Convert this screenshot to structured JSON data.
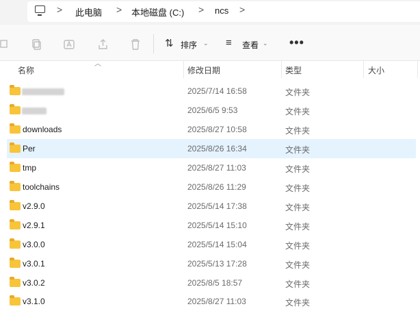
{
  "address_bar": {
    "crumbs": [
      "此电脑",
      "本地磁盘 (C:)",
      "ncs"
    ],
    "separator": ">"
  },
  "toolbar": {
    "sort_label": "排序",
    "view_label": "查看",
    "more_label": "•••"
  },
  "columns": {
    "name": "名称",
    "modified": "修改日期",
    "type": "类型",
    "size": "大小"
  },
  "files": [
    {
      "name": "",
      "modified": "2025/7/14 16:58",
      "type": "文件夹",
      "redacted": true
    },
    {
      "name": "",
      "modified": "2025/6/5 9:53",
      "type": "文件夹",
      "redacted": true
    },
    {
      "name": "downloads",
      "modified": "2025/8/27 10:58",
      "type": "文件夹"
    },
    {
      "name": "Per",
      "modified": "2025/8/26 16:34",
      "type": "文件夹",
      "selected": true
    },
    {
      "name": "tmp",
      "modified": "2025/8/27 11:03",
      "type": "文件夹"
    },
    {
      "name": "toolchains",
      "modified": "2025/8/26 11:29",
      "type": "文件夹"
    },
    {
      "name": "v2.9.0",
      "modified": "2025/5/14 17:38",
      "type": "文件夹"
    },
    {
      "name": "v2.9.1",
      "modified": "2025/5/14 15:10",
      "type": "文件夹"
    },
    {
      "name": "v3.0.0",
      "modified": "2025/5/14 15:04",
      "type": "文件夹"
    },
    {
      "name": "v3.0.1",
      "modified": "2025/5/13 17:28",
      "type": "文件夹"
    },
    {
      "name": "v3.0.2",
      "modified": "2025/8/5 18:57",
      "type": "文件夹"
    },
    {
      "name": "v3.1.0",
      "modified": "2025/8/27 11:03",
      "type": "文件夹"
    }
  ],
  "colors": {
    "folder": "#f8c43a",
    "selection": "#e5f3ff"
  }
}
